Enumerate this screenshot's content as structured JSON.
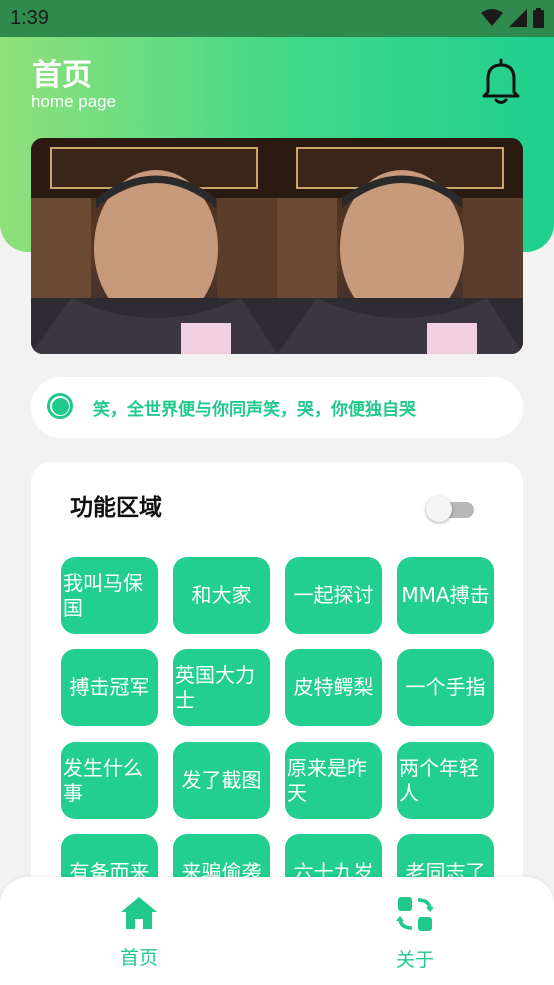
{
  "status_bar": {
    "time": "1:39"
  },
  "header": {
    "title": "首页",
    "subtitle": "home page"
  },
  "quote": "笑，全世界便与你同声笑，哭，你便独自哭",
  "function_area": {
    "title": "功能区域",
    "toggle_on": false,
    "buttons": [
      [
        "我叫马保国",
        "和大家",
        "一起探讨",
        "MMA搏击"
      ],
      [
        "搏击冠军",
        "英国大力士",
        "皮特鳄梨",
        "一个手指"
      ],
      [
        "发生什么事",
        "发了截图",
        "原来是昨天",
        "两个年轻人"
      ],
      [
        "有备而来",
        "来骗偷袭",
        "六十九岁",
        "老同志了"
      ]
    ]
  },
  "bottom_nav": {
    "home_label": "首页",
    "about_label": "关于"
  },
  "colors": {
    "accent": "#22c98d",
    "header_start": "#8fe07a",
    "header_end": "#1fcf8e"
  }
}
